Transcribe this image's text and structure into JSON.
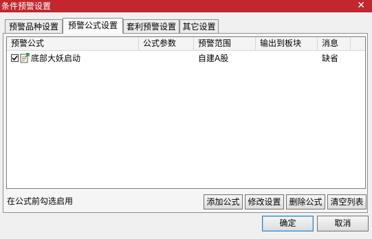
{
  "window": {
    "title": "条件预警设置",
    "close_glyph": "✕"
  },
  "tabs": [
    {
      "label": "预警品种设置",
      "active": false
    },
    {
      "label": "预警公式设置",
      "active": true
    },
    {
      "label": "套利预警设置",
      "active": false
    },
    {
      "label": "其它设置",
      "active": false
    }
  ],
  "table": {
    "columns": [
      "预警公式",
      "公式参数",
      "预警范围",
      "输出到板块",
      "消息"
    ],
    "rows": [
      {
        "checked": true,
        "icon": "formula-icon",
        "formula": "底部大妖启动",
        "params": "",
        "range": "自建A股",
        "output": "",
        "message": "缺省"
      }
    ]
  },
  "hint": "在公式前勾选启用",
  "buttons": {
    "add": "添加公式",
    "modify": "修改设置",
    "delete": "删除公式",
    "clear": "清空列表",
    "ok": "确定",
    "cancel": "取消"
  }
}
